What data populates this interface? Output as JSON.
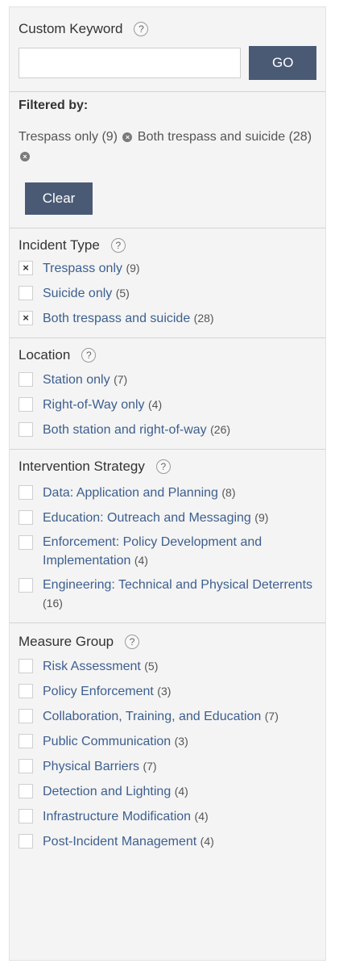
{
  "keyword": {
    "title": "Custom Keyword",
    "help_glyph": "?",
    "input_value": "",
    "input_placeholder": "",
    "go_label": "GO"
  },
  "filtered": {
    "label": "Filtered by:",
    "filters": [
      {
        "label": "Trespass only (9)",
        "remove_glyph": "×"
      },
      {
        "label": "Both trespass and suicide (28)",
        "remove_glyph": "×"
      }
    ],
    "clear_label": "Clear"
  },
  "incident_type": {
    "title": "Incident Type",
    "options": [
      {
        "label": "Trespass only",
        "count": "(9)",
        "check": "×"
      },
      {
        "label": "Suicide only",
        "count": "(5)",
        "check": ""
      },
      {
        "label": "Both trespass and suicide",
        "count": "(28)",
        "check": "×"
      }
    ]
  },
  "location": {
    "title": "Location",
    "options": [
      {
        "label": "Station only",
        "count": "(7)",
        "check": ""
      },
      {
        "label": "Right-of-Way only",
        "count": "(4)",
        "check": ""
      },
      {
        "label": "Both station and right-of-way",
        "count": "(26)",
        "check": ""
      }
    ]
  },
  "intervention": {
    "title": "Intervention Strategy",
    "options": [
      {
        "label": "Data: Application and Planning",
        "count": "(8)",
        "check": ""
      },
      {
        "label": "Education: Outreach and Messaging",
        "count": "(9)",
        "check": ""
      },
      {
        "label": "Enforcement: Policy Development and Implementation",
        "count": "(4)",
        "check": ""
      },
      {
        "label": "Engineering: Technical and Physical Deterrents",
        "count": "(16)",
        "check": ""
      }
    ]
  },
  "measure_group": {
    "title": "Measure Group",
    "options": [
      {
        "label": "Risk Assessment",
        "count": "(5)",
        "check": ""
      },
      {
        "label": "Policy Enforcement",
        "count": "(3)",
        "check": ""
      },
      {
        "label": "Collaboration, Training, and Education",
        "count": "(7)",
        "check": ""
      },
      {
        "label": "Public Communication",
        "count": "(3)",
        "check": ""
      },
      {
        "label": "Physical Barriers",
        "count": "(7)",
        "check": ""
      },
      {
        "label": "Detection and Lighting",
        "count": "(4)",
        "check": ""
      },
      {
        "label": "Infrastructure Modification",
        "count": "(4)",
        "check": ""
      },
      {
        "label": "Post-Incident Management",
        "count": "(4)",
        "check": ""
      }
    ]
  },
  "colors": {
    "button_bg": "#4a5a75",
    "link": "#3d5f8f",
    "panel_bg": "#f4f4f4"
  }
}
